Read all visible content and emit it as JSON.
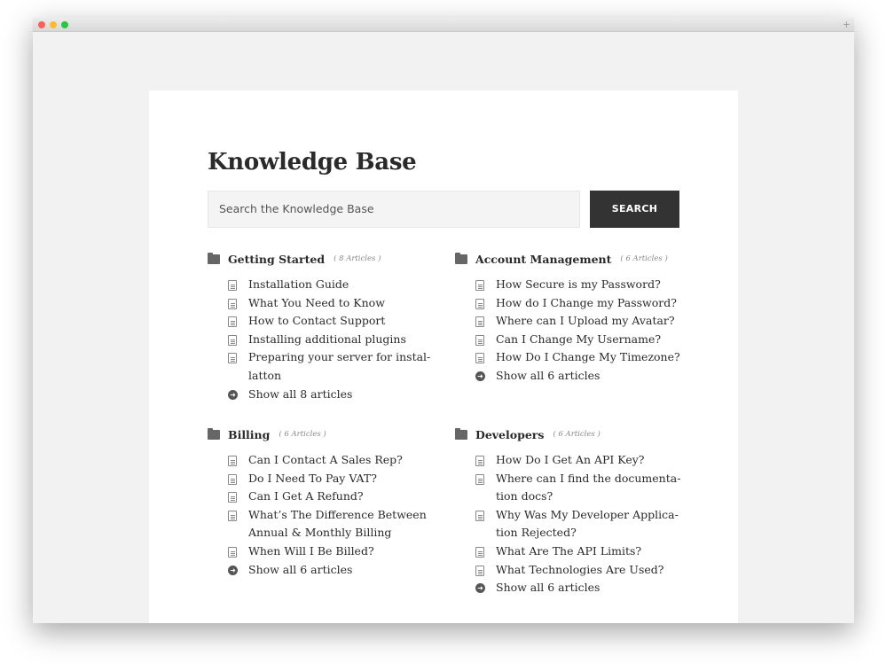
{
  "window": {
    "colors": {
      "close": "#fc5f57",
      "minimize": "#fdbc2e",
      "maximize": "#28c840"
    }
  },
  "page": {
    "title": "Knowledge Base",
    "search_placeholder": "Search the Knowledge Base",
    "search_button": "SEARCH"
  },
  "categories": [
    {
      "title": "Getting Started",
      "count": "( 8 Articles )",
      "articles": [
        "Installation Guide",
        "What You Need to Know",
        "How to Contact Support",
        "Installing additional plugins",
        "Preparing your server for instal-latton"
      ],
      "show_all": "Show all 8 articles"
    },
    {
      "title": "Account Management",
      "count": "( 6 Articles )",
      "articles": [
        "How Secure is my Password?",
        "How do I Change my Password?",
        "Where can I Upload my Avatar?",
        "Can I Change My Username?",
        "How Do I Change My Timezone?"
      ],
      "show_all": "Show all 6 articles"
    },
    {
      "title": "Billing",
      "count": "( 6 Articles )",
      "articles": [
        "Can I Contact A Sales Rep?",
        "Do I Need To Pay VAT?",
        "Can I Get A Refund?",
        "What’s The Difference Between Annual & Monthly Billing",
        "When Will I Be Billed?"
      ],
      "show_all": "Show all 6 articles"
    },
    {
      "title": "Developers",
      "count": "( 6 Articles )",
      "articles": [
        "How Do I Get An API Key?",
        "Where can I find the documenta-tion docs?",
        "Why Was My Developer Applica-tion Rejected?",
        "What Are The API Limits?",
        "What Technologies Are Used?"
      ],
      "show_all": "Show all 6 articles"
    }
  ]
}
